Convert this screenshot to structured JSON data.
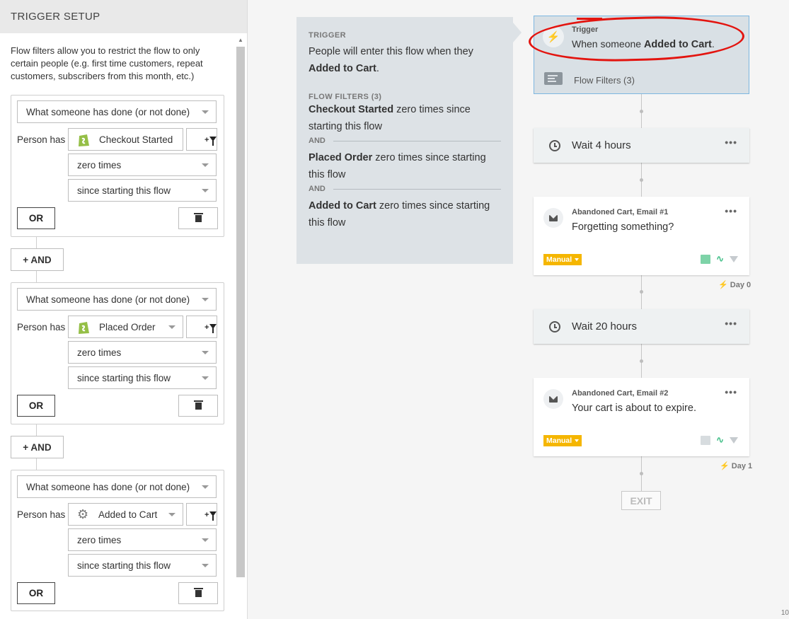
{
  "panel": {
    "title": "TRIGGER SETUP",
    "intro": "Flow filters allow you to restrict the flow to only certain people (e.g. first time customers, repeat customers, subscribers from this month, etc.)",
    "or_label": "OR",
    "and_label": "+ AND",
    "filters": [
      {
        "type": "What someone has done (or not done)",
        "person_label": "Person has",
        "metric": "Checkout Started",
        "metric_icon": "shopify-icon",
        "frequency": "zero times",
        "time_range": "since starting this flow"
      },
      {
        "type": "What someone has done (or not done)",
        "person_label": "Person has",
        "metric": "Placed Order",
        "metric_icon": "shopify-icon",
        "frequency": "zero times",
        "time_range": "since starting this flow"
      },
      {
        "type": "What someone has done (or not done)",
        "person_label": "Person has",
        "metric": "Added to Cart",
        "metric_icon": "gear-icon",
        "frequency": "zero times",
        "time_range": "since starting this flow"
      }
    ]
  },
  "summary": {
    "trigger_heading": "TRIGGER",
    "trigger_text": "People will enter this flow when they",
    "trigger_metric": "Added to Cart",
    "filters_heading": "FLOW FILTERS (3)",
    "and_label": "AND",
    "conditions": [
      {
        "metric": "Checkout Started",
        "text": "zero times since starting this flow"
      },
      {
        "metric": "Placed Order",
        "text": "zero times since starting this flow"
      },
      {
        "metric": "Added to Cart",
        "text": "zero times since starting this flow"
      }
    ]
  },
  "flow": {
    "trigger": {
      "label": "Trigger",
      "text_prefix": "When someone",
      "metric": "Added to Cart",
      "filters_label": "Flow Filters (3)"
    },
    "wait1": "Wait 4 hours",
    "email1": {
      "name": "Abandoned Cart, Email #1",
      "subject": "Forgetting something?",
      "status": "Manual",
      "day": "Day 0"
    },
    "wait2": "Wait 20 hours",
    "email2": {
      "name": "Abandoned Cart, Email #2",
      "subject": "Your cart is about to expire.",
      "status": "Manual",
      "day": "Day 1"
    },
    "exit_label": "EXIT",
    "more_label": "•••"
  },
  "corner_text": "10",
  "colors": {
    "highlight": "#e3140f",
    "badge": "#f5b600",
    "trigger_border": "#7cb6e0"
  }
}
